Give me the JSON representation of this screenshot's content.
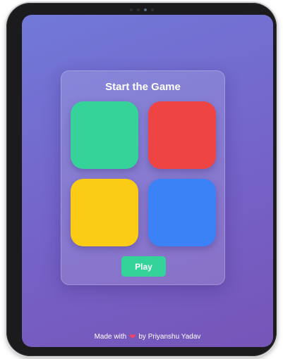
{
  "game": {
    "title": "Start the Game",
    "tiles": [
      {
        "color_name": "green",
        "color": "#35d399"
      },
      {
        "color_name": "red",
        "color": "#ef4444"
      },
      {
        "color_name": "yellow",
        "color": "#facc15"
      },
      {
        "color_name": "blue",
        "color": "#3b82f6"
      }
    ],
    "play_label": "Play"
  },
  "footer": {
    "prefix": "Made with",
    "heart_icon": "heart-icon",
    "heart_glyph": "❤",
    "suffix": "by Priyanshu Yadav"
  },
  "colors": {
    "background_start": "#7179d8",
    "background_end": "#7655b8",
    "play_button": "#34d399"
  }
}
